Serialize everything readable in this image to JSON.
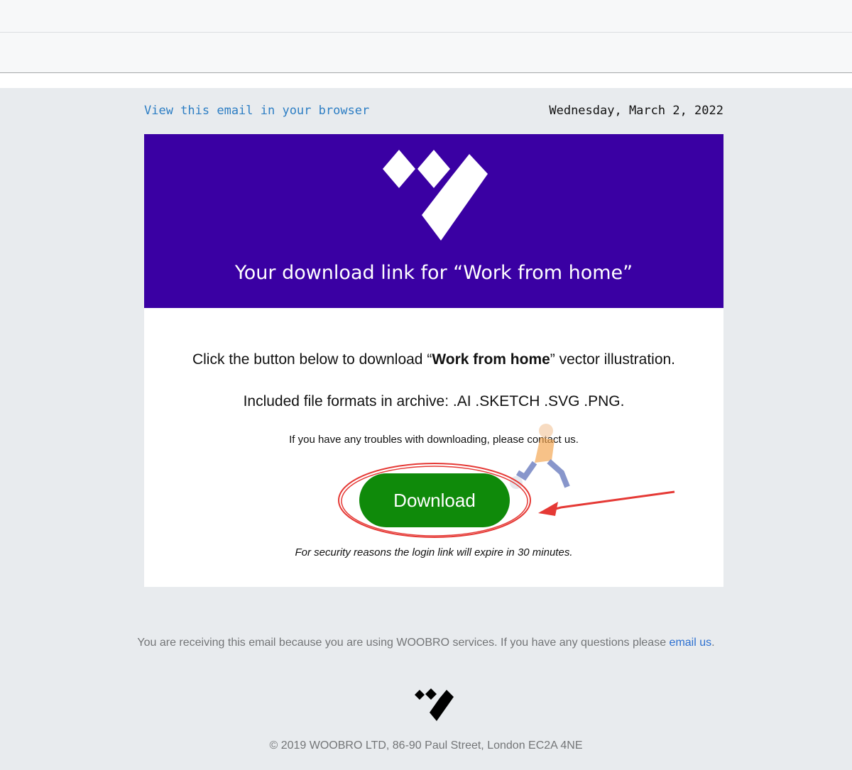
{
  "preheader": {
    "view_link": "View this email in your browser",
    "date": "Wednesday, March 2, 2022"
  },
  "hero": {
    "title": "Your download link for “Work from home”",
    "logo_icon": "woobro-logo-icon",
    "background": "#3a00a3"
  },
  "body": {
    "line1_prefix": "Click the button below to download “",
    "line1_bold": "Work from home",
    "line1_suffix": "” vector illustration.",
    "formats": "Included file formats in archive: .AI .SKETCH .SVG .PNG.",
    "troubles": "If you have any troubles with downloading, please contact us.",
    "download_label": "Download",
    "security_note": "For security reasons the login link will expire in 30 minutes."
  },
  "footer": {
    "text_prefix": "You are receiving this email because you are using WOOBRO services. If you have any questions please ",
    "email_link": "email us",
    "text_suffix": ".",
    "copyright": "© 2019 WOOBRO LTD, 86-90 Paul Street, London EC2A 4NE"
  },
  "colors": {
    "button": "#0f8a0a",
    "annotation": "#e53935",
    "link": "#2d7ec4"
  }
}
